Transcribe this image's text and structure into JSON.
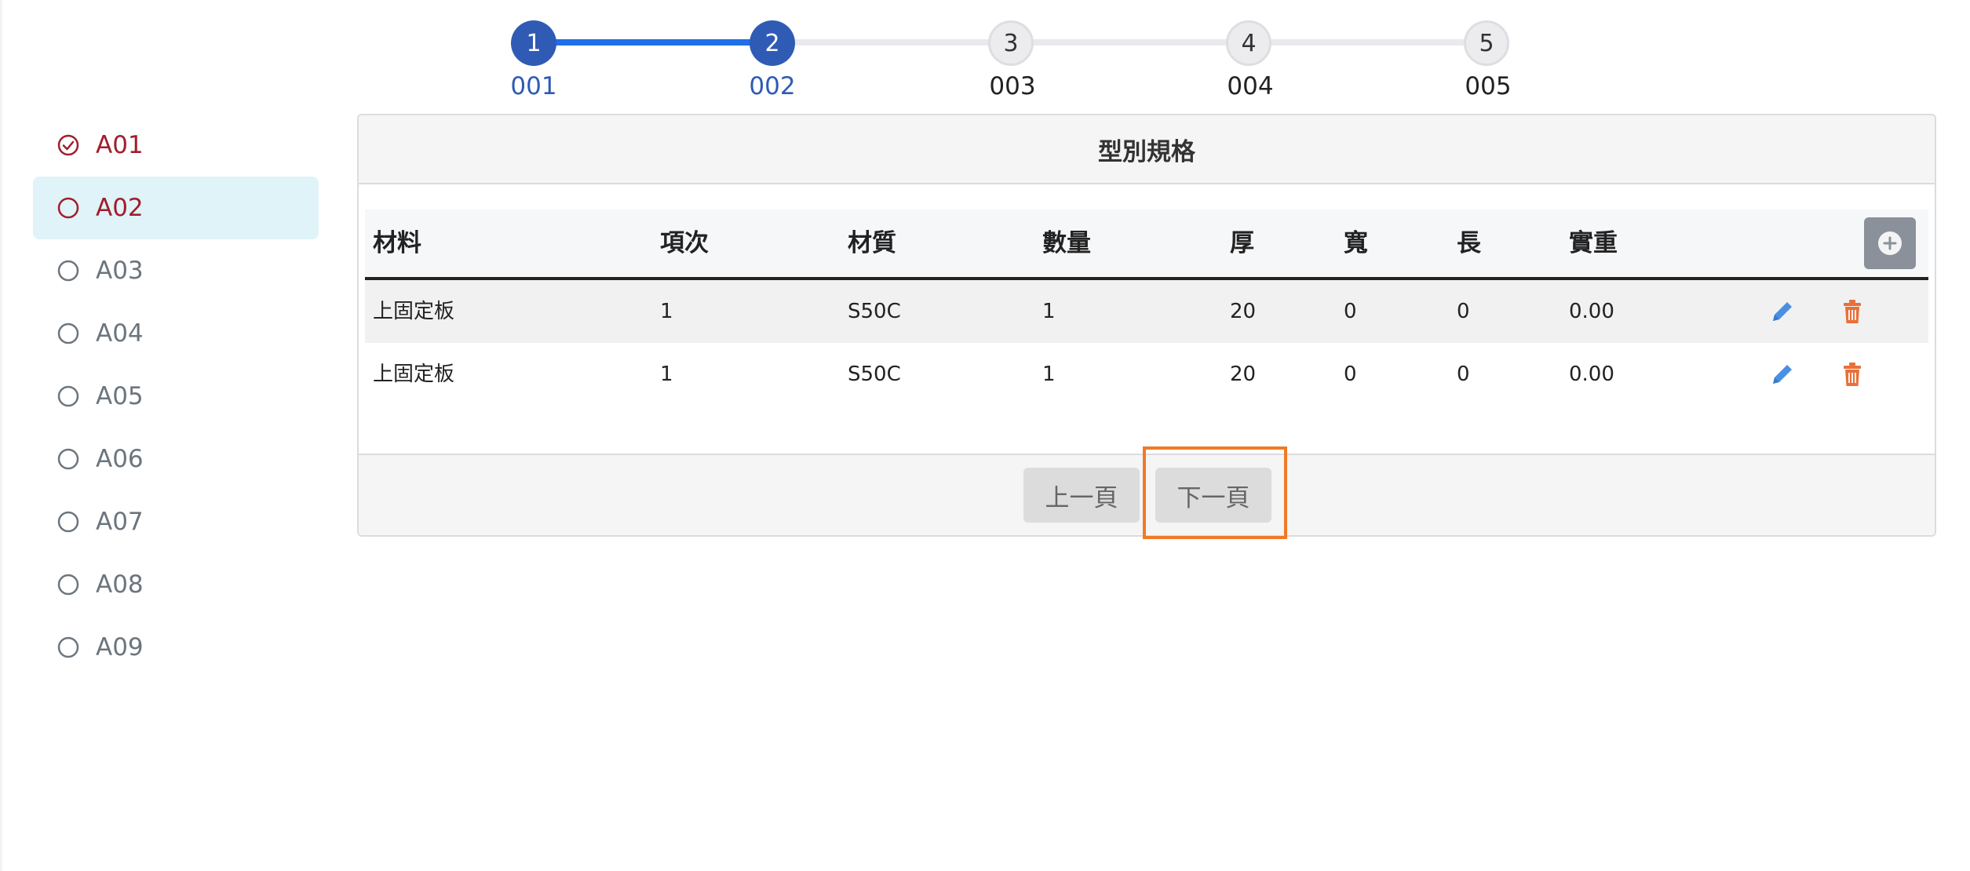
{
  "stepper": {
    "steps": [
      {
        "number": "1",
        "label": "001",
        "state": "done"
      },
      {
        "number": "2",
        "label": "002",
        "state": "done"
      },
      {
        "number": "3",
        "label": "003",
        "state": "todo"
      },
      {
        "number": "4",
        "label": "004",
        "state": "todo"
      },
      {
        "number": "5",
        "label": "005",
        "state": "todo"
      }
    ],
    "colors": {
      "active": "#2f5bb5",
      "track_active": "#1f6fe8",
      "track_idle": "#e9e9ee"
    }
  },
  "sidebar": {
    "items": [
      {
        "label": "A01",
        "state": "done",
        "icon": "check-circle-icon"
      },
      {
        "label": "A02",
        "state": "active",
        "icon": "circle-icon"
      },
      {
        "label": "A03",
        "state": "idle",
        "icon": "circle-icon"
      },
      {
        "label": "A04",
        "state": "idle",
        "icon": "circle-icon"
      },
      {
        "label": "A05",
        "state": "idle",
        "icon": "circle-icon"
      },
      {
        "label": "A06",
        "state": "idle",
        "icon": "circle-icon"
      },
      {
        "label": "A07",
        "state": "idle",
        "icon": "circle-icon"
      },
      {
        "label": "A08",
        "state": "idle",
        "icon": "circle-icon"
      },
      {
        "label": "A09",
        "state": "idle",
        "icon": "circle-icon"
      }
    ]
  },
  "card": {
    "title": "型別規格",
    "table": {
      "headers": [
        "材料",
        "項次",
        "材質",
        "數量",
        "厚",
        "寬",
        "長",
        "實重"
      ],
      "rows": [
        [
          "上固定板",
          "1",
          "S50C",
          "1",
          "20",
          "0",
          "0",
          "0.00"
        ],
        [
          "上固定板",
          "1",
          "S50C",
          "1",
          "20",
          "0",
          "0",
          "0.00"
        ]
      ],
      "add_icon": "plus-circle-icon",
      "edit_icon": "pencil-icon",
      "delete_icon": "trash-icon"
    },
    "footer": {
      "prev_label": "上一頁",
      "next_label": "下一頁"
    }
  },
  "colors": {
    "done_text": "#a11d2c",
    "active_bg": "#dff3f8",
    "edit_icon": "#4a90e2",
    "delete_icon": "#e8703a",
    "highlight": "#f07a25"
  }
}
